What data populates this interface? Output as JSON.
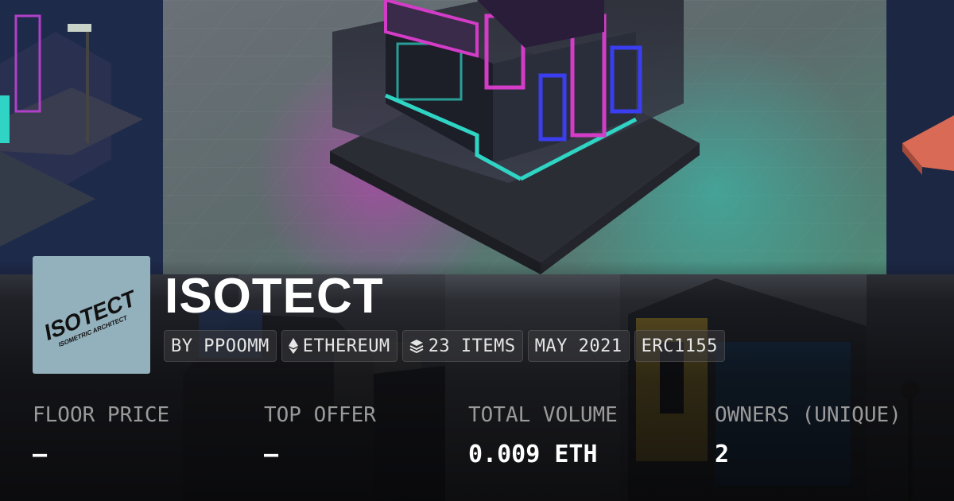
{
  "collection": {
    "title": "ISOTECT",
    "logo": {
      "line1": "ISOTECT",
      "line2": "ISOMETRIC ARCHITECT"
    },
    "chips": [
      {
        "id": "creator",
        "text": "BY PPOOMM",
        "icon": null
      },
      {
        "id": "chain",
        "text": "ETHEREUM",
        "icon": "ethereum-icon"
      },
      {
        "id": "items",
        "text": "23 ITEMS",
        "icon": "layers-icon"
      },
      {
        "id": "date",
        "text": "MAY 2021",
        "icon": null
      },
      {
        "id": "standard",
        "text": "ERC1155",
        "icon": null
      }
    ]
  },
  "stats": [
    {
      "label": "FLOOR PRICE",
      "value": "—"
    },
    {
      "label": "TOP OFFER",
      "value": "—"
    },
    {
      "label": "TOTAL VOLUME",
      "value": "0.009 ETH"
    },
    {
      "label": "OWNERS (UNIQUE)",
      "value": "2"
    }
  ],
  "colors": {
    "logo_bg": "#93b0bd",
    "neon_pink": "#d43cc8",
    "neon_cyan": "#2fd4c4",
    "neon_blue": "#3a3df0"
  }
}
